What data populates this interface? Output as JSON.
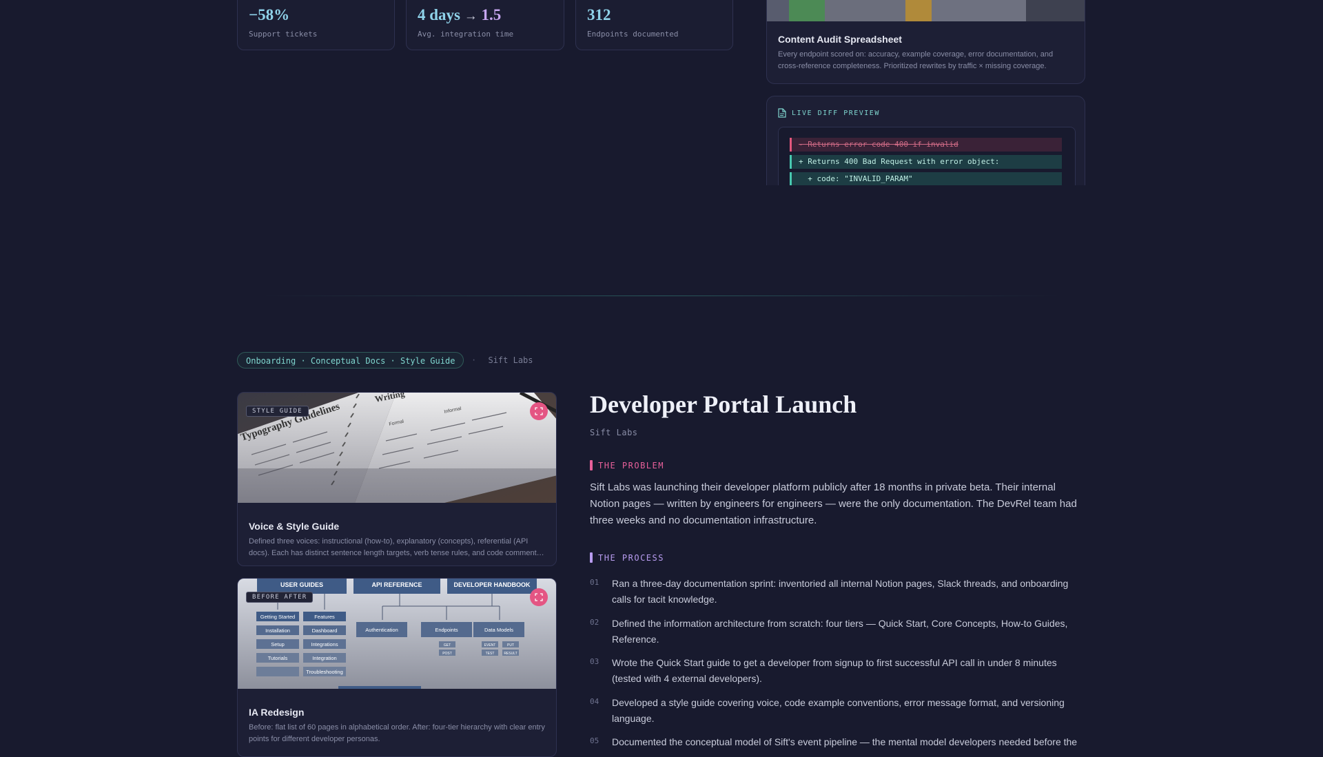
{
  "stats": [
    {
      "value": "−58%",
      "label": "Support tickets"
    },
    {
      "value_from": "4 days",
      "arrow": "→",
      "value_to": "1.5",
      "label": "Avg. integration time"
    },
    {
      "value": "312",
      "label": "Endpoints documented"
    }
  ],
  "audit_card": {
    "title": "Content Audit Spreadsheet",
    "description": "Every endpoint scored on: accuracy, example coverage, error documentation, and cross-reference completeness. Prioritized rewrites by traffic × missing coverage."
  },
  "diff": {
    "label": "LIVE DIFF PREVIEW",
    "lines": [
      {
        "type": "del",
        "text": "- Returns error code 400 if invalid"
      },
      {
        "type": "add",
        "text": "+ Returns 400 Bad Request with error object:"
      },
      {
        "type": "add",
        "text": "  + code: \"INVALID_PARAM\""
      }
    ]
  },
  "project": {
    "tags": "Onboarding · Conceptual Docs · Style Guide",
    "separator": "·",
    "client": "Sift Labs",
    "title": "Developer Portal Launch",
    "subtitle": "Sift Labs",
    "problem_label": "THE PROBLEM",
    "problem_text": "Sift Labs was launching their developer platform publicly after 18 months in private beta. Their internal Notion pages — written by engineers for engineers — were the only documentation. The DevRel team had three weeks and no documentation infrastructure.",
    "process_label": "THE PROCESS",
    "steps": [
      {
        "num": "01",
        "text": "Ran a three-day documentation sprint: inventoried all internal Notion pages, Slack threads, and onboarding calls for tacit knowledge."
      },
      {
        "num": "02",
        "text": "Defined the information architecture from scratch: four tiers — Quick Start, Core Concepts, How-to Guides, Reference."
      },
      {
        "num": "03",
        "text": "Wrote the Quick Start guide to get a developer from signup to first successful API call in under 8 minutes (tested with 4 external developers)."
      },
      {
        "num": "04",
        "text": "Developed a style guide covering voice, code example conventions, error message format, and versioning language."
      },
      {
        "num": "05",
        "text": "Documented the conceptual model of Sift's event pipeline — the mental model developers needed before the"
      }
    ]
  },
  "work_cards": [
    {
      "badge": "STYLE GUIDE",
      "title": "Voice & Style Guide",
      "description": "Defined three voices: instructional (how-to), explanatory (concepts), referential (API docs). Each has distinct sentence length targets, verb tense rules, and code comment conventions.",
      "image": {
        "page_left_title": "Typography Guidelines",
        "page_right_title": "Writing",
        "right_cols": [
          "Formal",
          "Informal"
        ]
      }
    },
    {
      "badge": "BEFORE AFTER",
      "title": "IA Redesign",
      "description": "Before: flat list of 60 pages in alphabetical order. After: four-tier hierarchy with clear entry points for different developer personas.",
      "image": {
        "headers": [
          "USER GUIDES",
          "API REFERENCE",
          "DEVELOPER HANDBOOK"
        ],
        "user_guides_col1": [
          "Getting Started",
          "Installation",
          "Setup",
          "Tutorials",
          ""
        ],
        "user_guides_col2": [
          "Features",
          "Dashboard",
          "Integrations",
          "Integration",
          "Troubleshooting"
        ],
        "api_nodes": [
          "Authentication",
          "Endpoints"
        ],
        "api_sub": [
          "GET",
          "POST"
        ],
        "handbook_node": "Data Models",
        "handbook_sub": [
          "EVENT",
          "PUT",
          "TEST",
          "RESULT"
        ]
      }
    }
  ],
  "colors": {
    "background": "#181a2e",
    "card": "#1d1f35",
    "accent_teal": "#48c9b0",
    "accent_pink": "#e7609a",
    "accent_violet": "#b89cf0",
    "stat_cyan": "#8fd3ea"
  }
}
